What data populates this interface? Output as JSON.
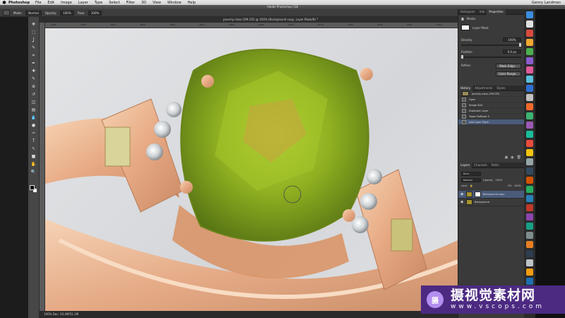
{
  "menubar": {
    "app": "Photoshop",
    "items": [
      "File",
      "Edit",
      "Image",
      "Layer",
      "Type",
      "Select",
      "Filter",
      "3D",
      "View",
      "Window",
      "Help"
    ],
    "right": [
      "Genny Landman"
    ]
  },
  "window": {
    "title": "Adobe Photoshop CS6"
  },
  "options": {
    "mode_label": "Mode:",
    "mode_value": "Normal",
    "opacity_label": "Opacity:",
    "opacity_value": "100%",
    "flow_label": "Flow:",
    "flow_value": "100%"
  },
  "document": {
    "tab_title": "peverly-class-199.CR2 @ 100% (Background copy, Layer Mask/8) *",
    "ruler_ticks": [
      "3700",
      "3750",
      "3800",
      "3850",
      "3900",
      "3950",
      "4000",
      "4050",
      "4100",
      "4150",
      "4200",
      "4250",
      "4300",
      "4350"
    ],
    "status": "100%     Doc: 20.4M/51.1M"
  },
  "properties": {
    "tabs": [
      "Histogram",
      "Info",
      "Properties"
    ],
    "active_tab": "Properties",
    "title": "Masks",
    "mask_label": "Layer Mask",
    "density_label": "Density:",
    "density_value": "100%",
    "feather_label": "Feather:",
    "feather_value": "0.0 px",
    "refine_label": "Refine:",
    "mask_edge_button": "Mask Edge...",
    "color_range_button": "Color Range...",
    "density_level": 1.0,
    "feather_level": 0.0
  },
  "history": {
    "tabs": [
      "History",
      "Adjustments",
      "Styles"
    ],
    "snapshot": "peverly-class-199.CR2",
    "items": [
      "Open",
      "Image Size",
      "Duplicate Layer",
      "Topaz DeNoise 5",
      "Add Layer Mask"
    ],
    "selected_index": 4
  },
  "layers": {
    "tabs": [
      "Layers",
      "Channels",
      "Paths"
    ],
    "kind_label": "Kind",
    "blend_mode": "Normal",
    "opacity_label": "Opacity:",
    "opacity_value": "100%",
    "lock_label": "Lock:",
    "fill_label": "Fill:",
    "fill_value": "100%",
    "rows": [
      {
        "name": "Background copy",
        "selected": true
      },
      {
        "name": "Background",
        "selected": false
      }
    ]
  },
  "tools": [
    "move-icon",
    "marquee-icon",
    "lasso-icon",
    "quick-select-icon",
    "crop-icon",
    "eyedropper-icon",
    "healing-icon",
    "brush-icon",
    "clone-stamp-icon",
    "history-brush-icon",
    "eraser-icon",
    "gradient-icon",
    "blur-icon",
    "dodge-icon",
    "pen-icon",
    "type-icon",
    "path-select-icon",
    "shape-icon",
    "hand-icon",
    "zoom-icon"
  ],
  "tool_glyphs": [
    "✥",
    "⬚",
    "ʆ",
    "✎",
    "⌗",
    "✒",
    "✚",
    "✎",
    "⊕",
    "↺",
    "◫",
    "▤",
    "💧",
    "●",
    "✑",
    "T",
    "↖",
    "■",
    "✋",
    "🔍"
  ],
  "watermark": {
    "logo": "摄",
    "title": "摄视觉素材网",
    "url": "www.vscops.com"
  }
}
